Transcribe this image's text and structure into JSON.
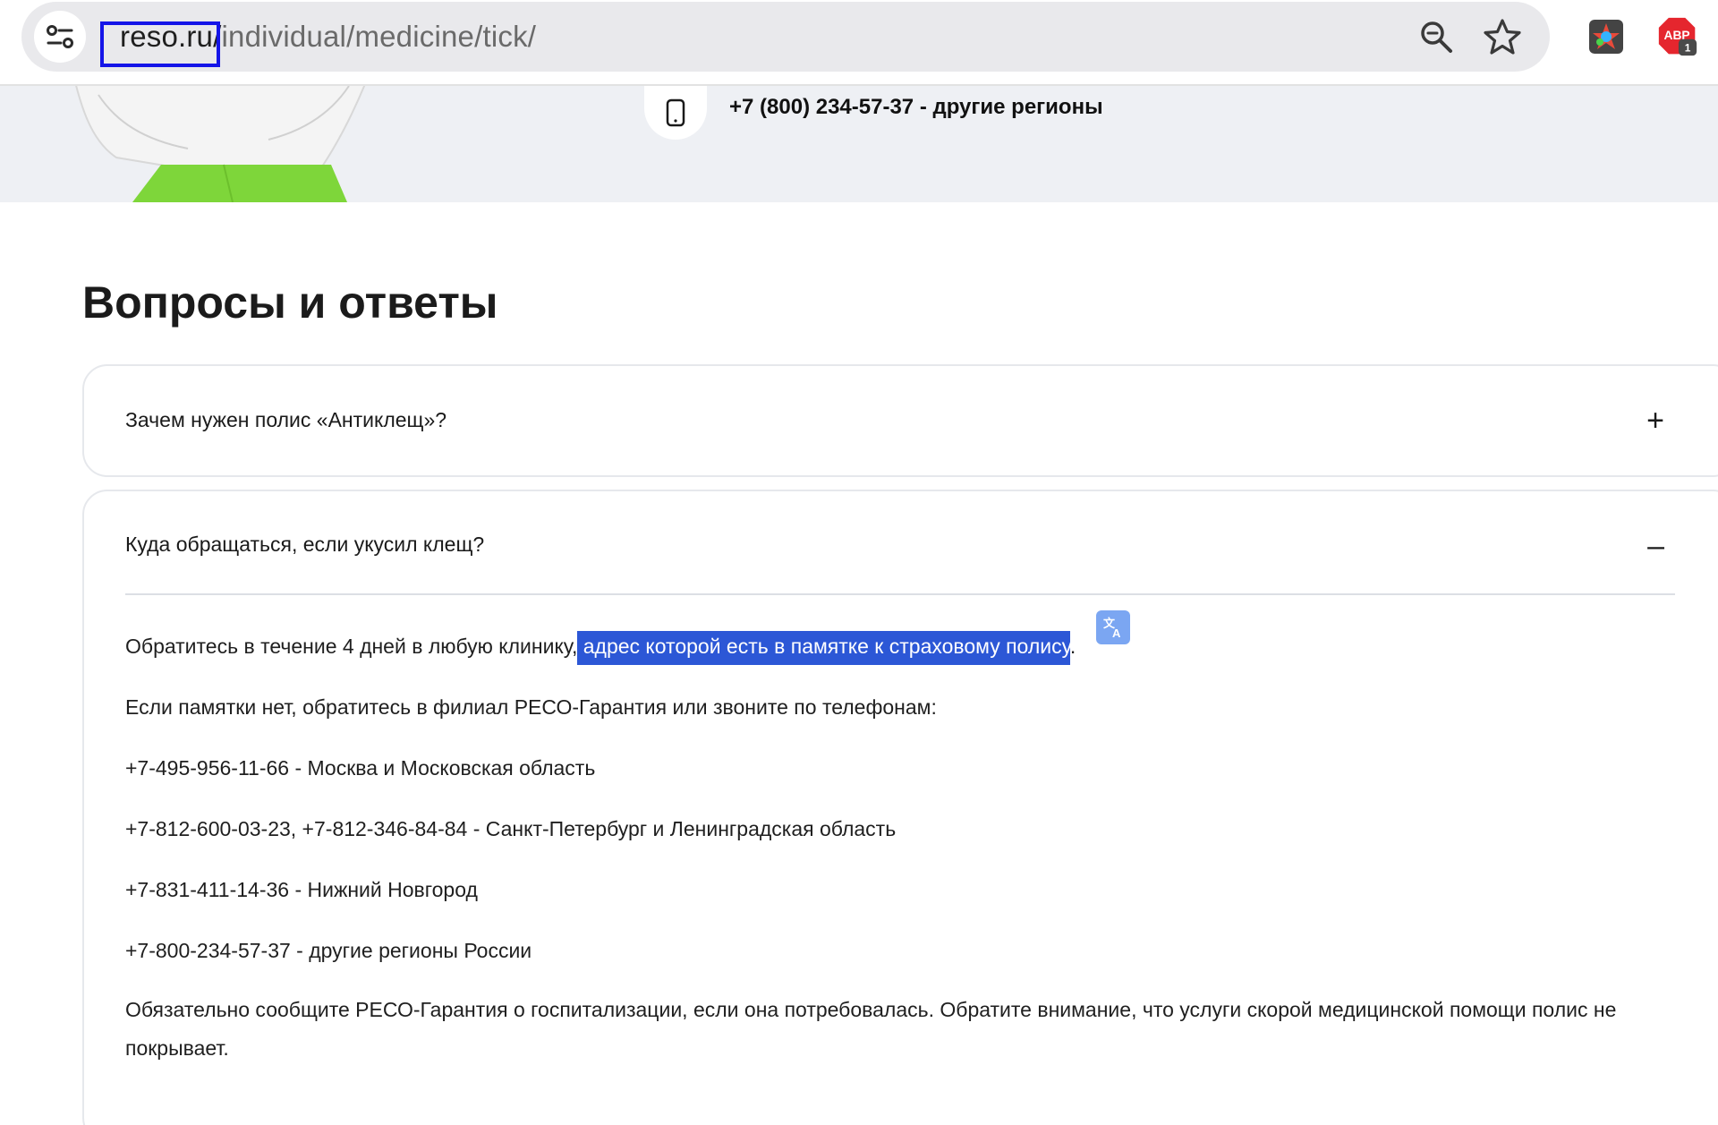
{
  "browser": {
    "url_host": "reso.ru/",
    "url_path": "individual/medicine/tick/",
    "extension_badge": "1",
    "extension_label": "ABP"
  },
  "hero": {
    "phone_text": "+7 (800) 234-57-37 - другие регионы"
  },
  "faq": {
    "title": "Вопросы и ответы",
    "items": [
      {
        "question": "Зачем нужен полис «Антиклещ»?",
        "toggle": "+"
      },
      {
        "question": "Куда обращаться, если укусил клещ?",
        "toggle": "–",
        "answer": {
          "line1_start": "Обратитесь в течение 4 дней в любую клинику,",
          "line1_selected": " адрес которой есть в памятке к страховому полису",
          "line1_end": ".",
          "line2": " Если памятки нет, обратитесь в филиал РЕСО-Гарантия или звоните по телефонам:",
          "line3": "+7-495-956-11-66 - Москва и Московская область",
          "line4": "+7-812-600-03-23, +7-812-346-84-84 - Санкт-Петербург и Ленинградская область",
          "line5": "+7-831-411-14-36 - Нижний Новгород",
          "line6": "+7-800-234-57-37 - другие регионы России",
          "line7": "Обязательно сообщите РЕСО-Гарантия о госпитализации, если она потребовалась. Обратите внимание, что услуги скорой медицинской помощи полис не покрывает."
        }
      }
    ]
  },
  "colors": {
    "selection": "#2c57d6",
    "highlight_box": "#1515e8",
    "accent_green": "#7ed63a",
    "hero_bg": "#eef0f4"
  },
  "icons": {
    "site_info": "tune-icon",
    "zoom": "zoom-icon",
    "bookmark": "star-icon",
    "extension1": "color-extension-icon",
    "extension2": "adblock-icon",
    "hero_phone": "mobile-phone-icon",
    "translate": "translate-icon"
  }
}
